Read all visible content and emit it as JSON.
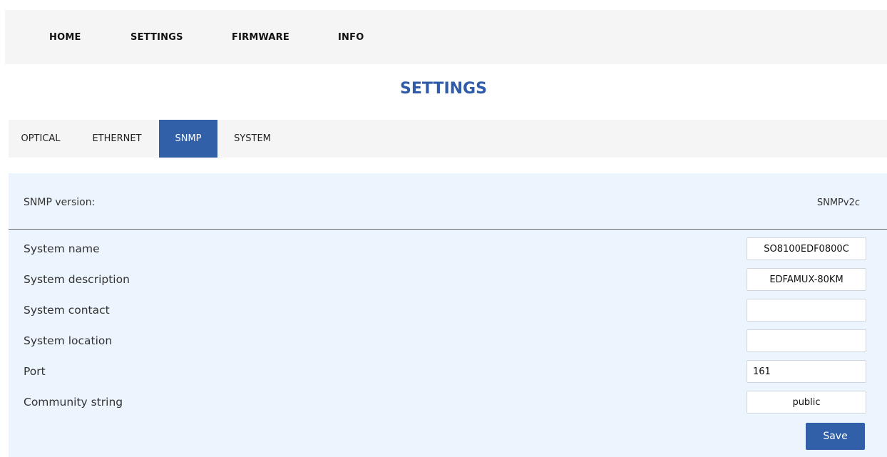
{
  "topnav": {
    "items": [
      {
        "label": "HOME"
      },
      {
        "label": "SETTINGS"
      },
      {
        "label": "FIRMWARE"
      },
      {
        "label": "INFO"
      }
    ]
  },
  "page_title": "SETTINGS",
  "tabs": [
    {
      "label": "OPTICAL",
      "active": false
    },
    {
      "label": "ETHERNET",
      "active": false
    },
    {
      "label": "SNMP",
      "active": true
    },
    {
      "label": "SYSTEM",
      "active": false
    }
  ],
  "snmp": {
    "version_label": "SNMP version:",
    "version_value": "SNMPv2c",
    "fields": [
      {
        "label": "System name",
        "value": "SO8100EDF0800C"
      },
      {
        "label": "System description",
        "value": "EDFAMUX-80KM"
      },
      {
        "label": "System contact",
        "value": ""
      },
      {
        "label": "System location",
        "value": ""
      },
      {
        "label": "Port",
        "value": "161"
      },
      {
        "label": "Community string",
        "value": "public"
      }
    ],
    "save_label": "Save"
  },
  "colors": {
    "accent": "#3160a8",
    "title": "#2f5ba8",
    "panel_bg": "#ecf5fd",
    "bar_bg": "#f5f5f5"
  }
}
